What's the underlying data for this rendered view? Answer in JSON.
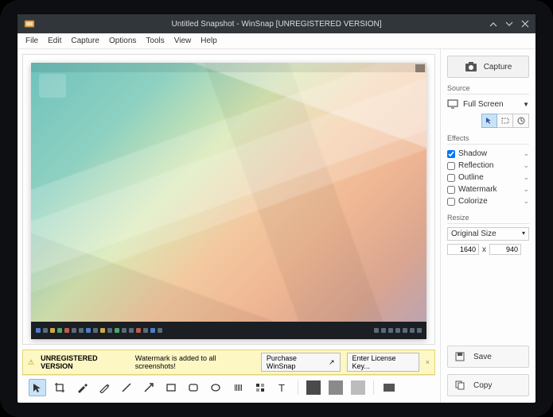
{
  "titlebar": {
    "title": "Untitled Snapshot - WinSnap [UNREGISTERED VERSION]"
  },
  "menubar": [
    "File",
    "Edit",
    "Capture",
    "Options",
    "Tools",
    "View",
    "Help"
  ],
  "nag": {
    "heading": "UNREGISTERED VERSION",
    "text": "Watermark is added to all screenshots!",
    "purchase": "Purchase WinSnap",
    "enter_key": "Enter License Key..."
  },
  "sidebar": {
    "capture": "Capture",
    "source": {
      "heading": "Source",
      "mode": "Full Screen"
    },
    "effects": {
      "heading": "Effects",
      "items": [
        {
          "label": "Shadow",
          "checked": true
        },
        {
          "label": "Reflection",
          "checked": false
        },
        {
          "label": "Outline",
          "checked": false
        },
        {
          "label": "Watermark",
          "checked": false
        },
        {
          "label": "Colorize",
          "checked": false
        }
      ]
    },
    "resize": {
      "heading": "Resize",
      "mode": "Original Size",
      "w": "1640",
      "h": "940",
      "sep": "x"
    },
    "save": "Save",
    "copy": "Copy"
  }
}
